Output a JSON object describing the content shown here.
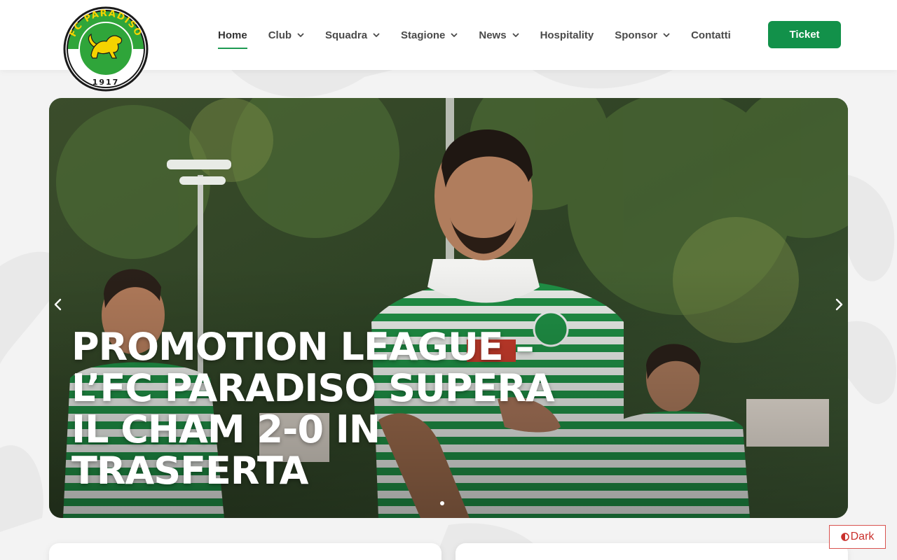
{
  "logo": {
    "top_text": "FC PARADISO",
    "year": "1917",
    "colors": {
      "green": "#2fa53a",
      "yellow": "#f5d300",
      "black": "#1a1a1a"
    }
  },
  "nav": {
    "items": [
      {
        "label": "Home",
        "active": true,
        "dropdown": false
      },
      {
        "label": "Club",
        "dropdown": true
      },
      {
        "label": "Squadra",
        "dropdown": true
      },
      {
        "label": "Stagione",
        "dropdown": true
      },
      {
        "label": "News",
        "dropdown": true
      },
      {
        "label": "Hospitality",
        "dropdown": false
      },
      {
        "label": "Sponsor",
        "dropdown": true
      },
      {
        "label": "Contatti",
        "dropdown": false
      }
    ],
    "ticket_label": "Ticket",
    "accent_color": "#12914a"
  },
  "hero": {
    "title": "PROMOTION LEAGUE – L’FC PARADISO SUPERA IL CHAM 2-0 IN TRASFERTA",
    "prev_icon": "chevron-left-icon",
    "next_icon": "chevron-right-icon"
  },
  "theme_toggle": {
    "label": "Dark",
    "icon": "half-circle-icon"
  }
}
